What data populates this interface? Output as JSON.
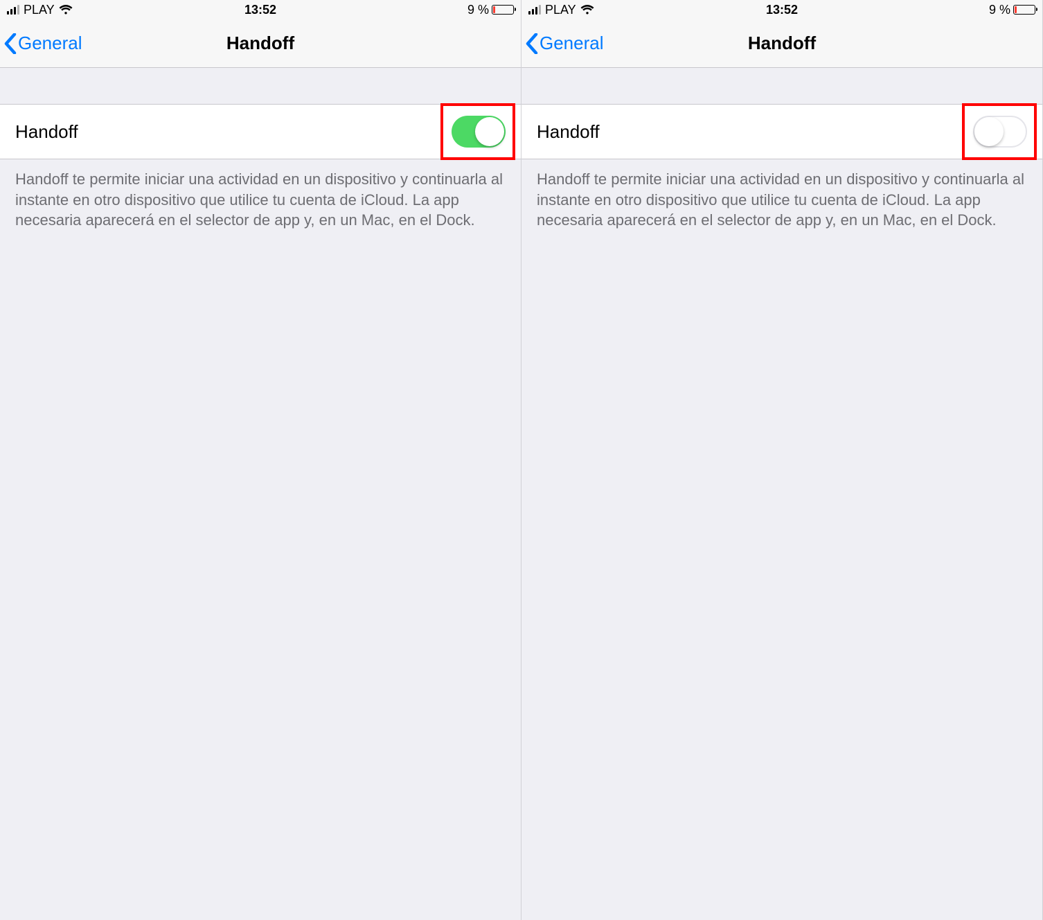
{
  "screens": [
    {
      "status": {
        "carrier": "PLAY",
        "time": "13:52",
        "battery_text": "9 %"
      },
      "nav": {
        "back_label": "General",
        "title": "Handoff"
      },
      "setting": {
        "label": "Handoff",
        "toggle_on": true
      },
      "footer": "Handoff te permite iniciar una actividad en un dispositivo y continuarla al instante en otro dispositivo que utilice tu cuenta de iCloud. La app necesaria aparecerá en el selector de app y, en un Mac, en el Dock."
    },
    {
      "status": {
        "carrier": "PLAY",
        "time": "13:52",
        "battery_text": "9 %"
      },
      "nav": {
        "back_label": "General",
        "title": "Handoff"
      },
      "setting": {
        "label": "Handoff",
        "toggle_on": false
      },
      "footer": "Handoff te permite iniciar una actividad en un dispositivo y continuarla al instante en otro dispositivo que utilice tu cuenta de iCloud. La app necesaria aparecerá en el selector de app y, en un Mac, en el Dock."
    }
  ],
  "colors": {
    "accent": "#007aff",
    "toggle_on": "#4cd964",
    "highlight": "#ff0000",
    "battery_low": "#ff3b30"
  }
}
